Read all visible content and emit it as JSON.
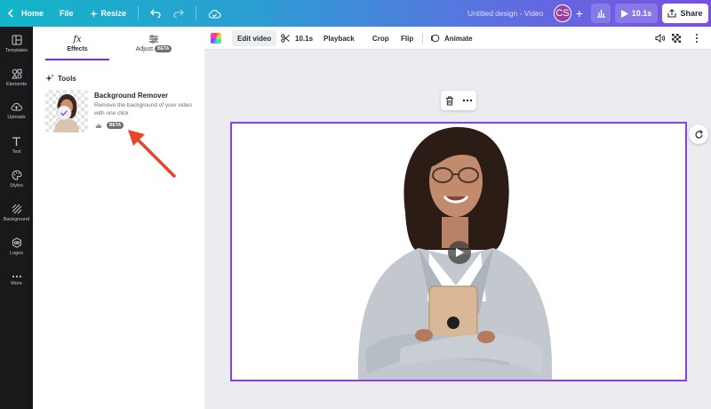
{
  "topbar": {
    "home_label": "Home",
    "file_label": "File",
    "resize_label": "Resize",
    "title": "Untitled design - Video",
    "avatar_initials": "CS",
    "add_label": "+",
    "duration_label": "10.1s",
    "share_label": "Share"
  },
  "rail": {
    "items": [
      {
        "label": "Templates",
        "icon": "templates-icon"
      },
      {
        "label": "Elements",
        "icon": "elements-icon"
      },
      {
        "label": "Uploads",
        "icon": "uploads-icon"
      },
      {
        "label": "Text",
        "icon": "text-icon"
      },
      {
        "label": "Styles",
        "icon": "styles-icon"
      },
      {
        "label": "Background",
        "icon": "background-icon"
      },
      {
        "label": "Logos",
        "icon": "logos-icon"
      },
      {
        "label": "More",
        "icon": "more-icon"
      }
    ]
  },
  "panel": {
    "tabs": [
      {
        "label": "Effects",
        "icon_text": "fx",
        "active": true
      },
      {
        "label": "Adjust",
        "badge": "BETA",
        "active": false
      }
    ],
    "tools_heading": "Tools",
    "tool": {
      "title": "Background Remover",
      "description": "Remove the background of your video with one click",
      "badge": "BETA"
    }
  },
  "ctxbar": {
    "edit_video_label": "Edit video",
    "trim_label": "10.1s",
    "playback_label": "Playback",
    "crop_label": "Crop",
    "flip_label": "Flip",
    "animate_label": "Animate"
  },
  "colors": {
    "accent": "#8b3dff",
    "annotation_arrow": "#e8442e",
    "rail_bg": "#18191b",
    "canvas_bg": "#ebecf0"
  }
}
